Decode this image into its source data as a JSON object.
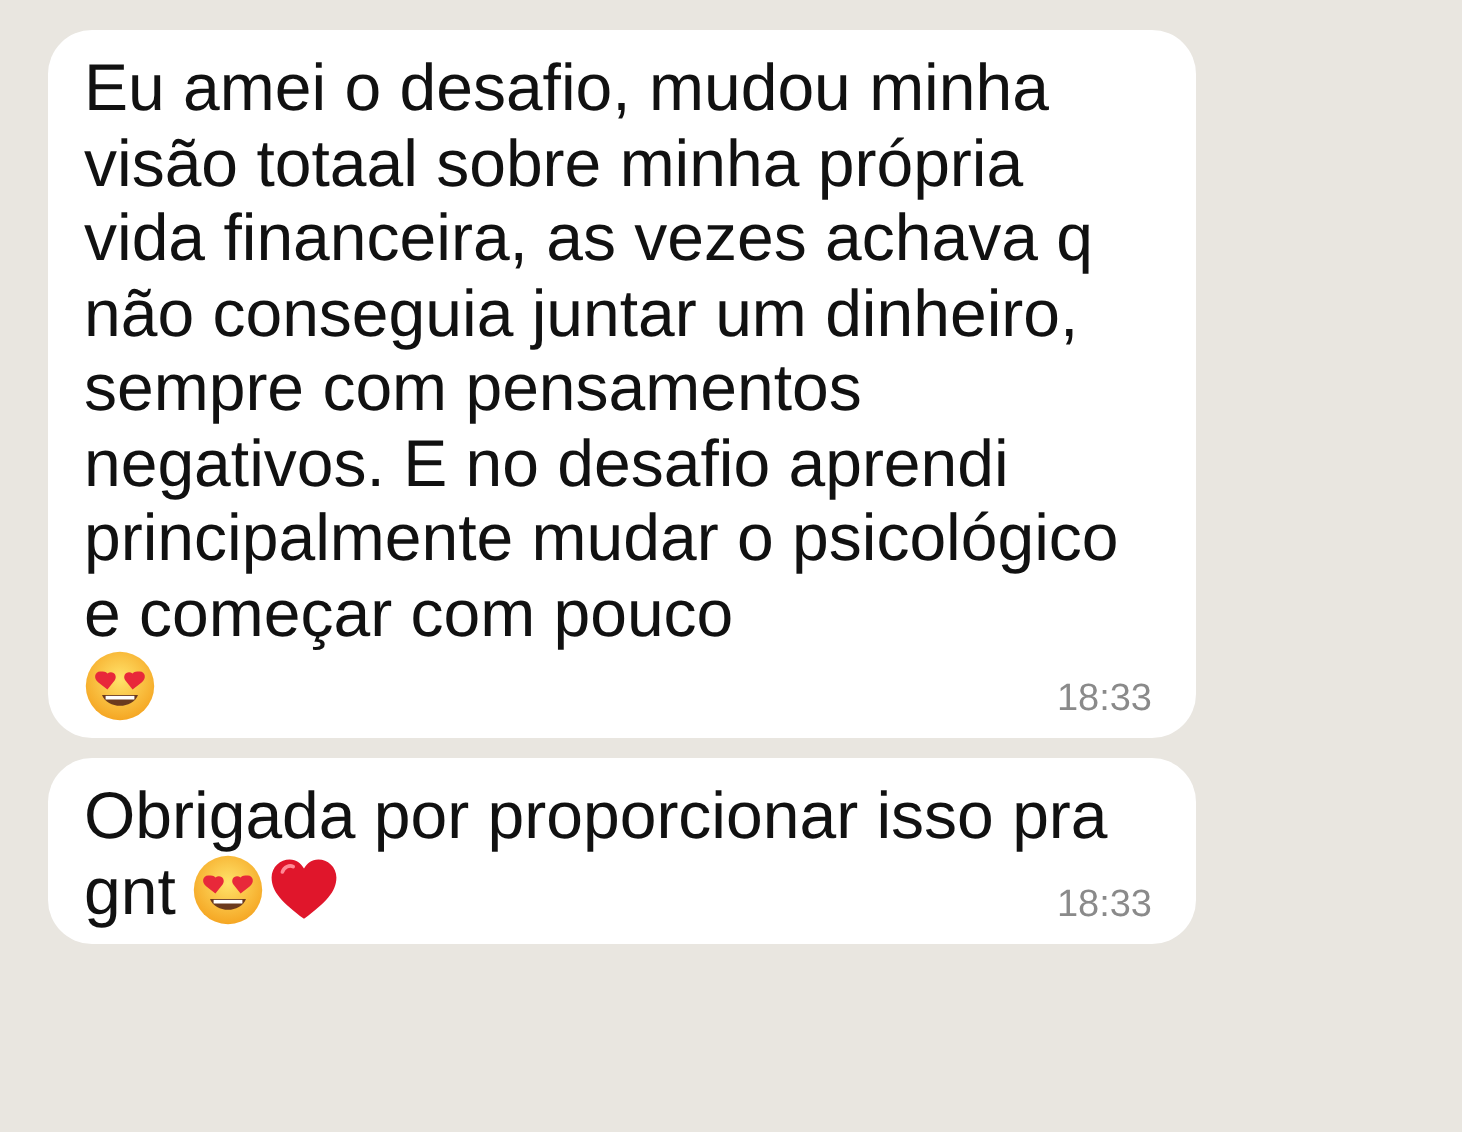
{
  "messages": [
    {
      "text": "Eu amei o desafio, mudou minha visão totaal sobre minha própria vida financeira, as vezes achava q não conseguia juntar um dinheiro, sempre com pensamentos negativos. E no desafio aprendi principalmente mudar o psicológico e começar com pouco",
      "last_line": {
        "emojis": [
          {
            "kind": "heart-eyes"
          }
        ]
      },
      "time": "18:33"
    },
    {
      "text": "Obrigada por proporcionar isso pra",
      "last_line": {
        "text": "gnt",
        "emojis": [
          {
            "kind": "heart-eyes"
          },
          {
            "kind": "heart"
          }
        ]
      },
      "time": "18:33"
    }
  ]
}
